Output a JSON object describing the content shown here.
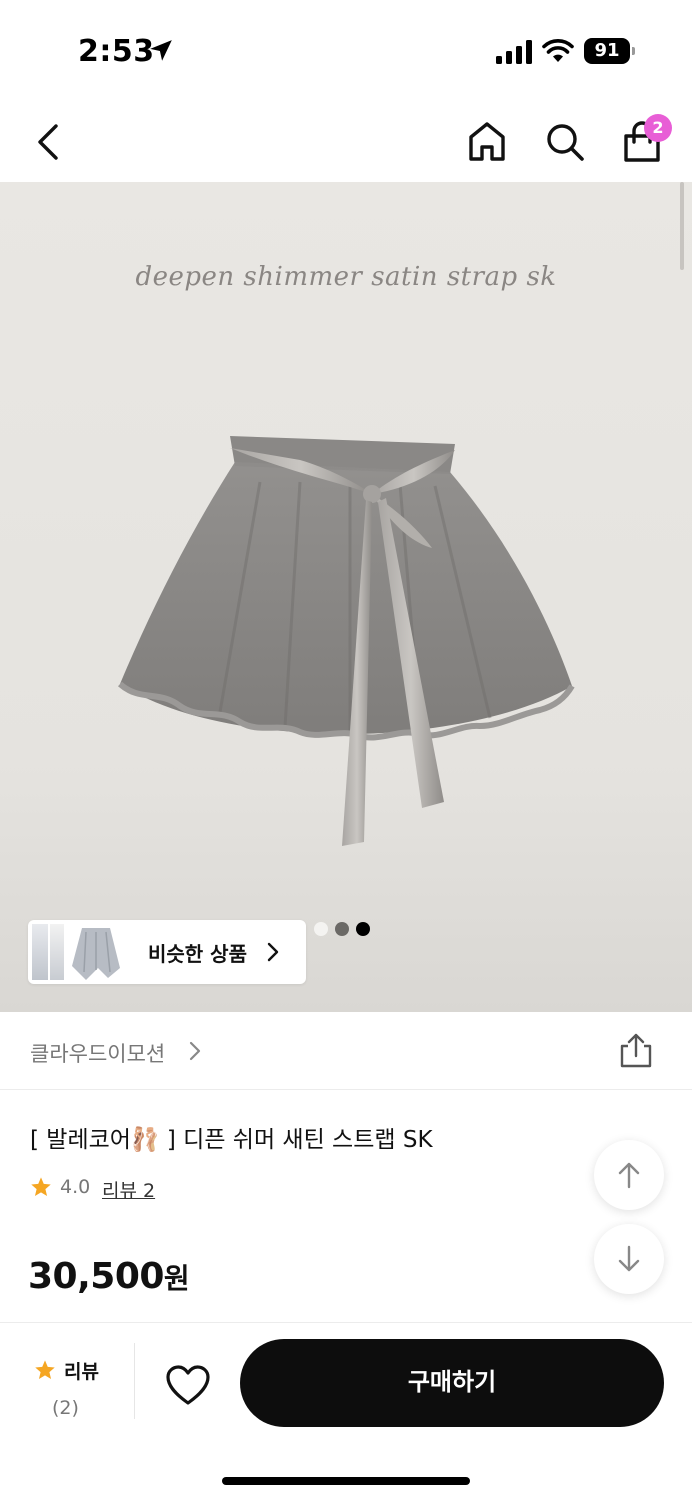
{
  "status_bar": {
    "time": "2:53",
    "battery": "91"
  },
  "nav": {
    "cart_count": "2"
  },
  "hero": {
    "caption": "deepen shimmer satin strap sk",
    "similar_label": "비슷한 상품",
    "carousel": {
      "total": 3,
      "active_index": 2
    }
  },
  "shop": {
    "name": "클라우드이모션"
  },
  "product": {
    "title": "[ 발레코어🩰 ] 디픈 쉬머 새틴 스트랩 SK",
    "rating": "4.0",
    "review_link": "리뷰 2",
    "price": "30,500",
    "price_unit": "원"
  },
  "bottom_bar": {
    "review_label": "리뷰",
    "review_count": "(2)",
    "buy_label": "구매하기"
  },
  "colors": {
    "accent_badge": "#e85ed6",
    "star": "#f5a623",
    "buy_button": "#0d0d0d"
  }
}
